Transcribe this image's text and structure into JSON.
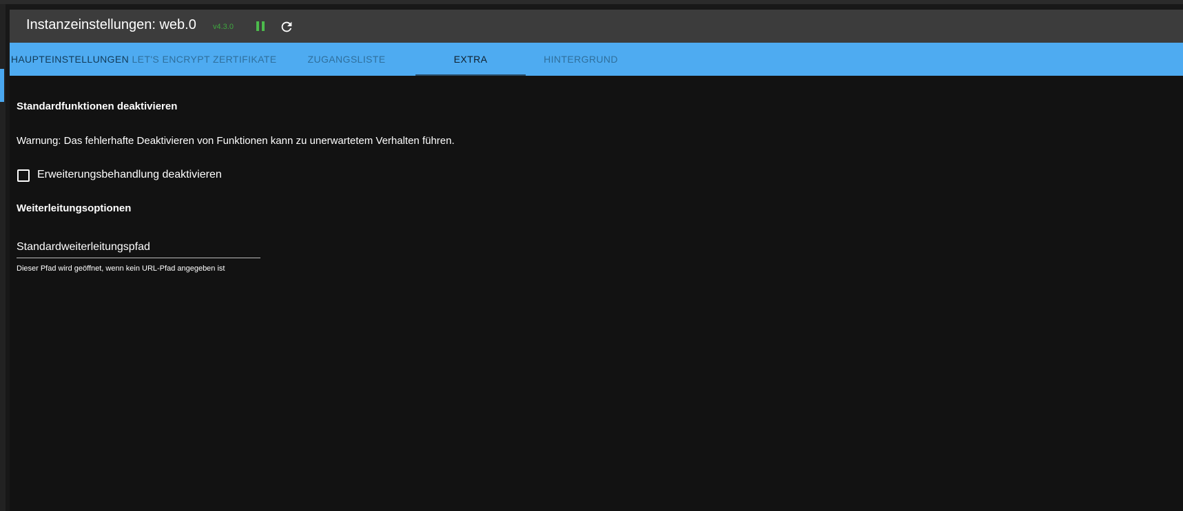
{
  "dialog": {
    "title": "Instanzeinstellungen: web.0",
    "version": "v4.3.0",
    "pause_icon": "pause-icon",
    "reload_icon": "reload-icon",
    "colors": {
      "title_bar": "#3c3c3c",
      "tab_bar": "#4eabf1",
      "content_bg": "#121212",
      "version_green": "#3fa83f",
      "pause_green": "#4cbb4c"
    }
  },
  "tabs": [
    {
      "label": "HAUPTEINSTELLUNGEN",
      "active": false
    },
    {
      "label": "LET'S ENCRYPT ZERTIFIKATE",
      "active": false
    },
    {
      "label": "ZUGANGSLISTE",
      "active": false
    },
    {
      "label": "EXTRA",
      "active": true
    },
    {
      "label": "HINTERGRUND",
      "active": false
    }
  ],
  "extra": {
    "section1_heading": "Standardfunktionen deaktivieren",
    "warning": "Warnung: Das fehlerhafte Deaktivieren von Funktionen kann zu unerwartetem Verhalten führen.",
    "checkbox": {
      "label": "Erweiterungsbehandlung deaktivieren",
      "checked": false
    },
    "section2_heading": "Weiterleitungsoptionen",
    "redirect_field": {
      "value": "Standardweiterleitungspfad",
      "helper": "Dieser Pfad wird geöffnet, wenn kein URL-Pfad angegeben ist"
    }
  }
}
